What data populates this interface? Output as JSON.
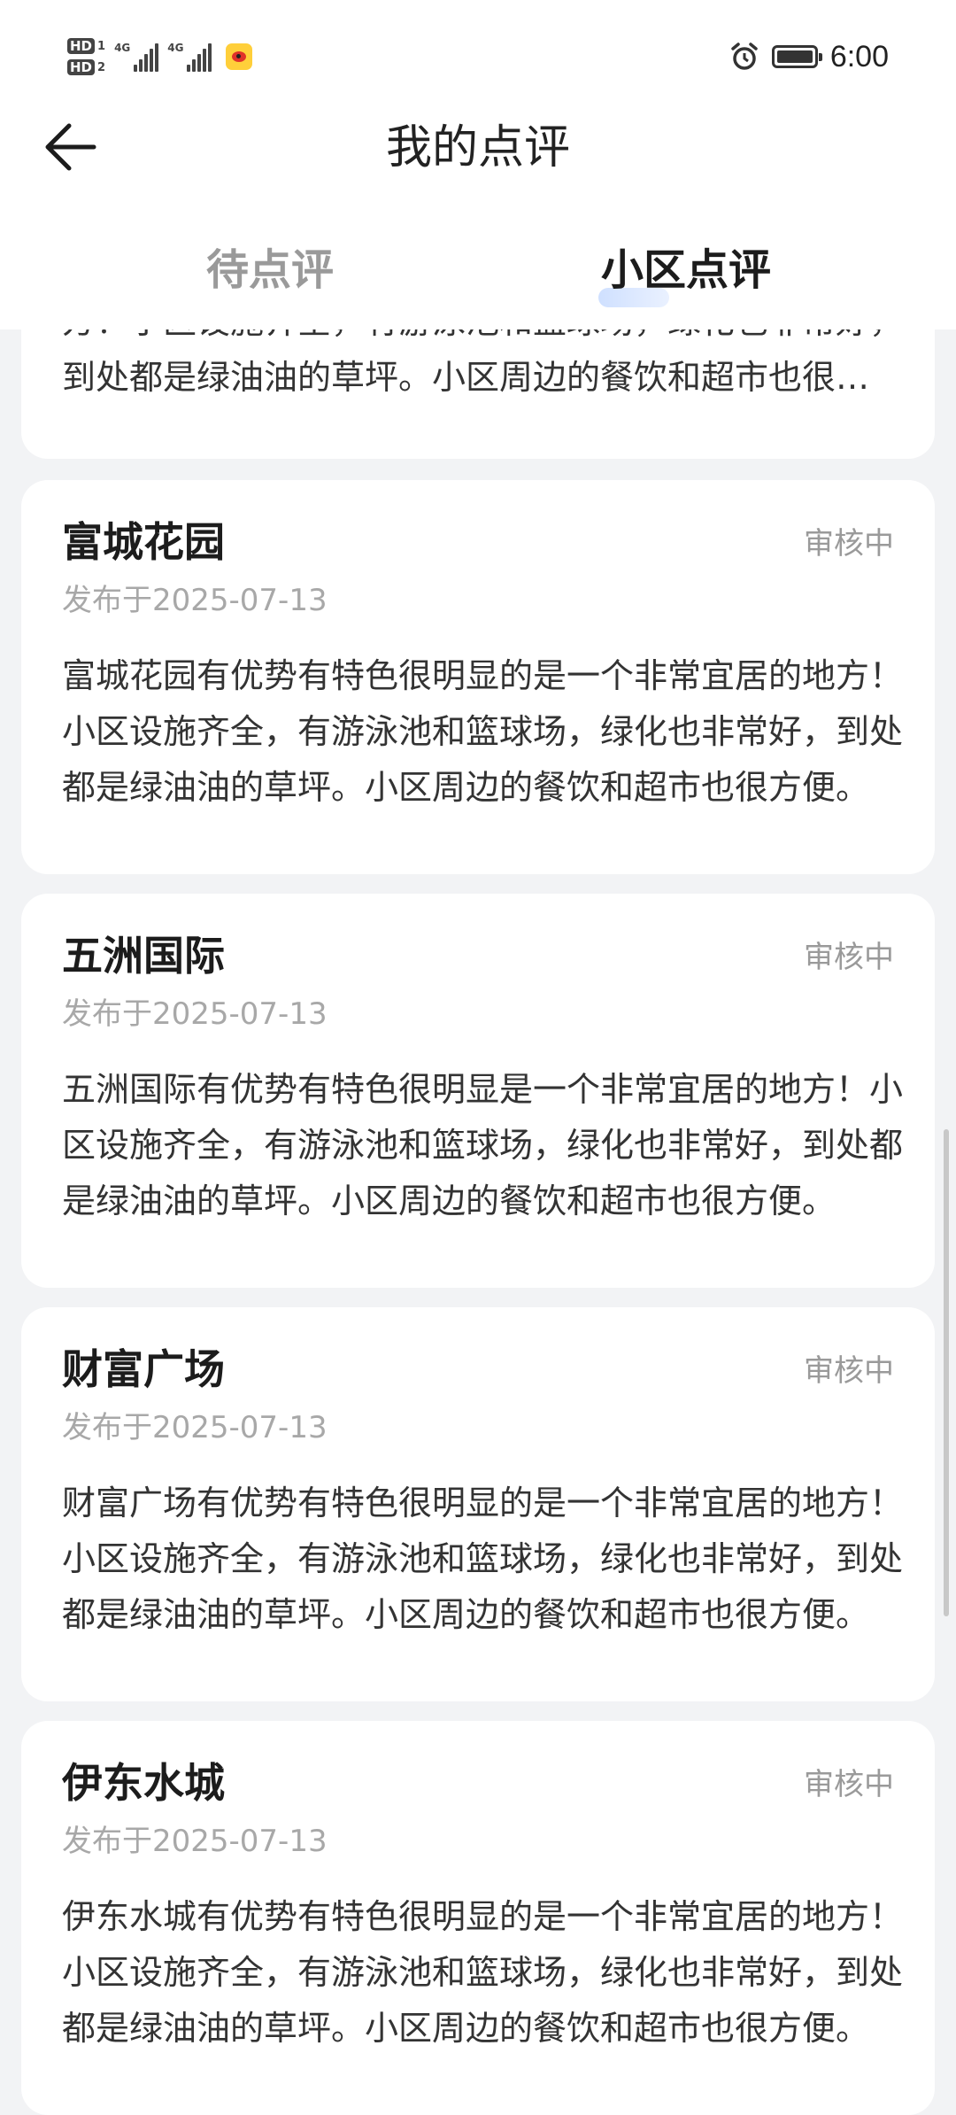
{
  "status_bar": {
    "hd1": "HD",
    "hd1_num": "1",
    "hd2": "HD",
    "hd2_num": "2",
    "sig1_label": "4G",
    "sig2_label": "4G",
    "time": "6:00",
    "icons": [
      "alarm-icon",
      "battery-icon",
      "weibo-icon"
    ]
  },
  "header": {
    "title": "我的点评",
    "back_icon": "back-arrow-icon"
  },
  "tabs": [
    {
      "label": "待点评",
      "active": false
    },
    {
      "label": "小区点评",
      "active": true
    }
  ],
  "partial_card": {
    "body": "方！小区设施齐全，有游泳池和篮球场，绿化也非常好，到处都是绿油油的草坪。小区周边的餐饮和超市也很方便。"
  },
  "reviews": [
    {
      "name": "富城花园",
      "status": "审核中",
      "date": "发布于2025-07-13",
      "body": "富城花园有优势有特色很明显的是一个非常宜居的地方！小区设施齐全，有游泳池和篮球场，绿化也非常好，到处都是绿油油的草坪。小区周边的餐饮和超市也很方便。"
    },
    {
      "name": "五洲国际",
      "status": "审核中",
      "date": "发布于2025-07-13",
      "body": "五洲国际有优势有特色很明显是一个非常宜居的地方！小区设施齐全，有游泳池和篮球场，绿化也非常好，到处都是绿油油的草坪。小区周边的餐饮和超市也很方便。"
    },
    {
      "name": "财富广场",
      "status": "审核中",
      "date": "发布于2025-07-13",
      "body": "财富广场有优势有特色很明显的是一个非常宜居的地方！小区设施齐全，有游泳池和篮球场，绿化也非常好，到处都是绿油油的草坪。小区周边的餐饮和超市也很方便。"
    },
    {
      "name": "伊东水城",
      "status": "审核中",
      "date": "发布于2025-07-13",
      "body": "伊东水城有优势有特色很明显的是一个非常宜居的地方！小区设施齐全，有游泳池和篮球场，绿化也非常好，到处都是绿油油的草坪。小区周边的餐饮和超市也很方便。"
    }
  ],
  "colors": {
    "background": "#f2f3f5",
    "card": "#ffffff",
    "muted_text": "#9a9a9a",
    "tab_indicator": "#cfe0ff"
  }
}
